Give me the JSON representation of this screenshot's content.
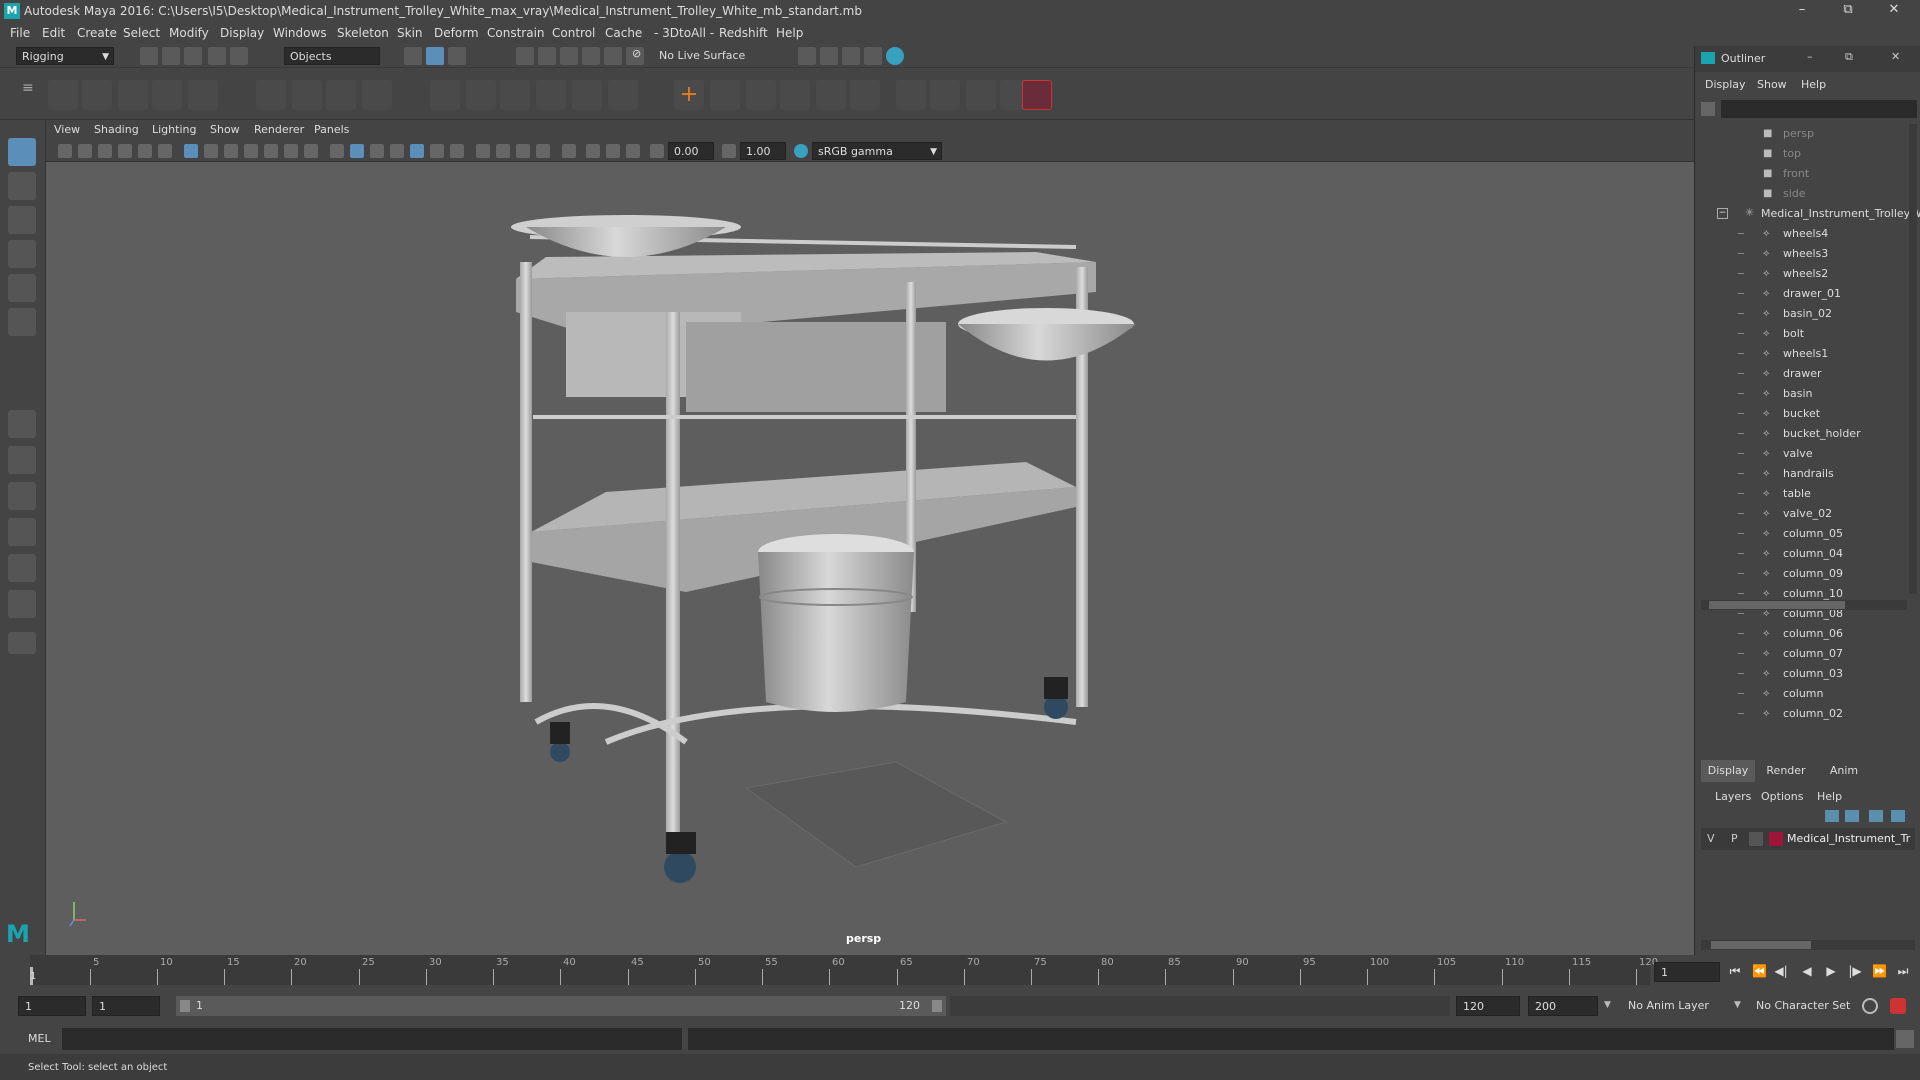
{
  "window": {
    "title": "Autodesk Maya 2016: C:\\Users\\I5\\Desktop\\Medical_Instrument_Trolley_White_max_vray\\Medical_Instrument_Trolley_White_mb_standart.mb",
    "controls": [
      "–",
      "⧉",
      "✕"
    ]
  },
  "menu": [
    "File",
    "Edit",
    "Create",
    "Select",
    "Modify",
    "Display",
    "Windows",
    "Skeleton",
    "Skin",
    "Deform",
    "Constrain",
    "Control",
    "Cache",
    "- 3DtoAll -",
    "Redshift",
    "Help"
  ],
  "statusline": {
    "mode": "Rigging",
    "select_mode": "Objects",
    "live_surface": "No Live Surface"
  },
  "viewport": {
    "menu": [
      "View",
      "Shading",
      "Lighting",
      "Show",
      "Renderer",
      "Panels"
    ],
    "exposure": "0.00",
    "gamma": "1.00",
    "color_space": "sRGB gamma",
    "camera_label": "persp"
  },
  "outliner": {
    "title": "Outliner",
    "menu": [
      "Display",
      "Show",
      "Help"
    ],
    "cameras": [
      "persp",
      "top",
      "front",
      "side"
    ],
    "group": "Medical_Instrument_Trolley_W",
    "items": [
      "wheels4",
      "wheels3",
      "wheels2",
      "drawer_01",
      "basin_02",
      "bolt",
      "wheels1",
      "drawer",
      "basin",
      "bucket",
      "bucket_holder",
      "valve",
      "handrails",
      "table",
      "valve_02",
      "column_05",
      "column_04",
      "column_09",
      "column_10",
      "column_08",
      "column_06",
      "column_07",
      "column_03",
      "column",
      "column_02"
    ]
  },
  "layers": {
    "tabs": [
      "Display",
      "Render",
      "Anim"
    ],
    "menu": [
      "Layers",
      "Options",
      "Help"
    ],
    "layer": {
      "v": "V",
      "p": "P",
      "name": "Medical_Instrument_Tr",
      "color": "#a0143a"
    }
  },
  "timeline": {
    "ticks": [
      5,
      10,
      15,
      20,
      25,
      30,
      35,
      40,
      45,
      50,
      55,
      60,
      65,
      70,
      75,
      80,
      85,
      90,
      95,
      100,
      105,
      110,
      115,
      120
    ],
    "current_frame": "1",
    "playback_icons": [
      "⏮",
      "⏪",
      "◀|",
      "◀",
      "▶",
      "|▶",
      "⏩",
      "⏭"
    ]
  },
  "range": {
    "start": "1",
    "start2": "1",
    "slider_start": "1",
    "slider_end": "120",
    "end": "120",
    "end2": "200",
    "anim_layer": "No Anim Layer",
    "char_set": "No Character Set"
  },
  "cmd": {
    "label": "MEL"
  },
  "help": {
    "text": "Select Tool: select an object"
  }
}
